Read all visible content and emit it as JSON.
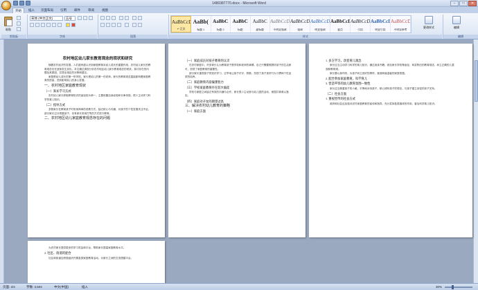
{
  "window": {
    "title": "1480387770.docx - Microsoft Word",
    "min": "–",
    "max": "□",
    "close": "✕"
  },
  "tabs": [
    "开始",
    "插入",
    "页面布局",
    "引用",
    "邮件",
    "审阅",
    "视图"
  ],
  "ribbon": {
    "paste_label": "粘贴",
    "font_name": "宋体 (中文正文)",
    "font_size": "五号",
    "groups": [
      "剪贴板",
      "字体",
      "段落",
      "样式",
      "编辑"
    ],
    "styles": [
      {
        "sample": "AaBbCcDd",
        "name": "↵ 正文"
      },
      {
        "sample": "AaBb(",
        "name": "标题 1"
      },
      {
        "sample": "AaBbC",
        "name": "标题 2"
      },
      {
        "sample": "AaBbC",
        "name": "标题"
      },
      {
        "sample": "AaBbC",
        "name": "副标题"
      },
      {
        "sample": "AaBbCcDd",
        "name": "不明显强调"
      },
      {
        "sample": "AaBbCcDd",
        "name": "强调"
      },
      {
        "sample": "AaBbCcDd",
        "name": "明显强调"
      },
      {
        "sample": "AaBbCcDd",
        "name": "要点"
      },
      {
        "sample": "AaBbCcDd",
        "name": "引用"
      },
      {
        "sample": "AaBbCcDd",
        "name": "明显引用"
      },
      {
        "sample": "AaBbCcDd",
        "name": "不明显参考"
      }
    ],
    "change_styles": "更改样式",
    "edit_label": "编辑"
  },
  "document": {
    "title": "农村地区幼儿家长教育观念的现状和研究",
    "page1": {
      "paras": [
        "随着农村经济的发展，人们越来越认识到家庭教育对幼儿成长的重要作用，农村幼儿家长的教育观念也在逐渐发生变化。本文通过调查分析农村地区幼儿家长教育观念的现状，探讨存在的问题及其原因，并提出相应的对策和建议。",
        "家庭是幼儿成长的第一所学校，家长是幼儿的第一任老师。家长的教育观念直接影响着家庭教育的质量，进而影响幼儿的身心发展。"
      ],
      "h1": "一、农村地区家庭教育现状",
      "h2a": "（一）家长学习方式",
      "para_mid": "农村幼儿家长获取教育知识的途径较为单一，主要依靠自身经验和长辈传授，很少主动学习科学的育儿知识。",
      "h2b": "（二）指导方式",
      "para_end": "多数家长在教育孩子时采用简单的说教方式，缺乏耐心与沟通，对孩子的个性发展关注不足。部分家长过分溺爱孩子，也有家长采用打骂的方式进行教育。",
      "h1b": "二、农村地区幼儿家庭教育观念存在的问题"
    },
    "page2": {
      "h2a": "（一）家庭成员对孩子教育的认识",
      "paras": [
        "在农村家庭中，许多家长认为教育孩子是学校和老师的事情，自己只需要照顾好孩子的生活即可，忽视了家庭教育的重要性。",
        "部分家长重视孩子的知识学习，过早地让孩子识字、算数，忽视了孩子良好行为习惯和个性品质的培养。"
      ],
      "h2b": "（二）家庭教育内容偏重智力",
      "h2c": "（三）学校家庭教育存在较大偏差",
      "para_c": "学校与家庭之间缺乏有效的沟通与合作，家长很少主动参与幼儿园的活动，家园共育难以落实。",
      "h2d": "（四）家庭对子女的期望过高",
      "h1": "三、解决农村幼儿教育的策略",
      "h2e": "（一）家庭方面"
    },
    "page3": {
      "h2a": "1. 多方学习，改变育儿观念",
      "paras": [
        "家长应当主动学习科学的育儿知识，通过阅读书籍、参加家长学校等途径，转变陈旧的教育观念，树立正确的儿童观和教育观。",
        "家长要以身作则，为孩子树立良好的榜样，营造和谐温馨的家庭氛围。"
      ],
      "h2b": "2. 配合参加家庭教育，科学育儿",
      "h2c": "3. 营造平等的幼儿教育氛围一致性",
      "para_c": "家长应当尊重孩子的人格，平等地对待孩子，耐心倾听孩子的想法，与孩子建立亲密的亲子关系。",
      "h2d": "（二）社会方面",
      "h2e": "1. 重视宣传的社会方式",
      "para_e": "政府和社会应加强对农村家庭教育的宣传和指导，充分发挥各类媒体的作用，普及科学育儿知识。"
    },
    "page4": {
      "para_a": "为农村家长提供更多的学习机会和平台，帮助家长提高家庭教育水平。",
      "h2a": "2. 社区、街道的配合",
      "para_b": "社区和街道应积极组织开展各类家庭教育活动，为家长之间的交流搭建平台。"
    }
  },
  "status": {
    "page": "页面: 2/4",
    "words": "字数: 3,504",
    "lang": "中文(中国)",
    "insert": "插入",
    "zoom": "30%",
    "zoom_level": 0.3
  }
}
